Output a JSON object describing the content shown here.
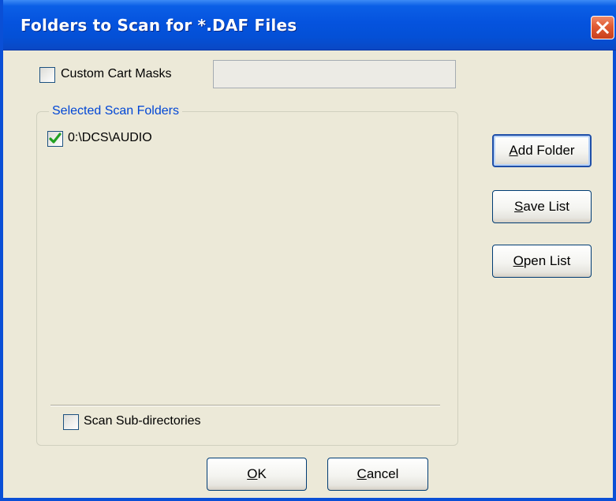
{
  "window": {
    "title": "Folders to Scan for *.DAF Files"
  },
  "custom_masks": {
    "checked": false,
    "label": "Custom Cart Masks",
    "input_value": ""
  },
  "scan_folders": {
    "group_label": "Selected Scan Folders",
    "items": [
      {
        "label": "0:\\DCS\\AUDIO",
        "checked": true
      }
    ]
  },
  "subdirs": {
    "checked": false,
    "label": "Scan Sub-directories"
  },
  "side_buttons": {
    "add_folder": {
      "accel": "A",
      "rest": "dd Folder"
    },
    "save_list": {
      "accel": "S",
      "rest": "ave List"
    },
    "open_list": {
      "accel": "O",
      "rest": "pen List"
    }
  },
  "footer_buttons": {
    "ok": {
      "accel": "O",
      "rest": "K"
    },
    "cancel": {
      "accel": "C",
      "rest": "ancel"
    }
  },
  "colors": {
    "titlebar": "#0553de",
    "group_label": "#0046d5",
    "check_mark": "#21a121",
    "close_button": "#e05a32"
  }
}
